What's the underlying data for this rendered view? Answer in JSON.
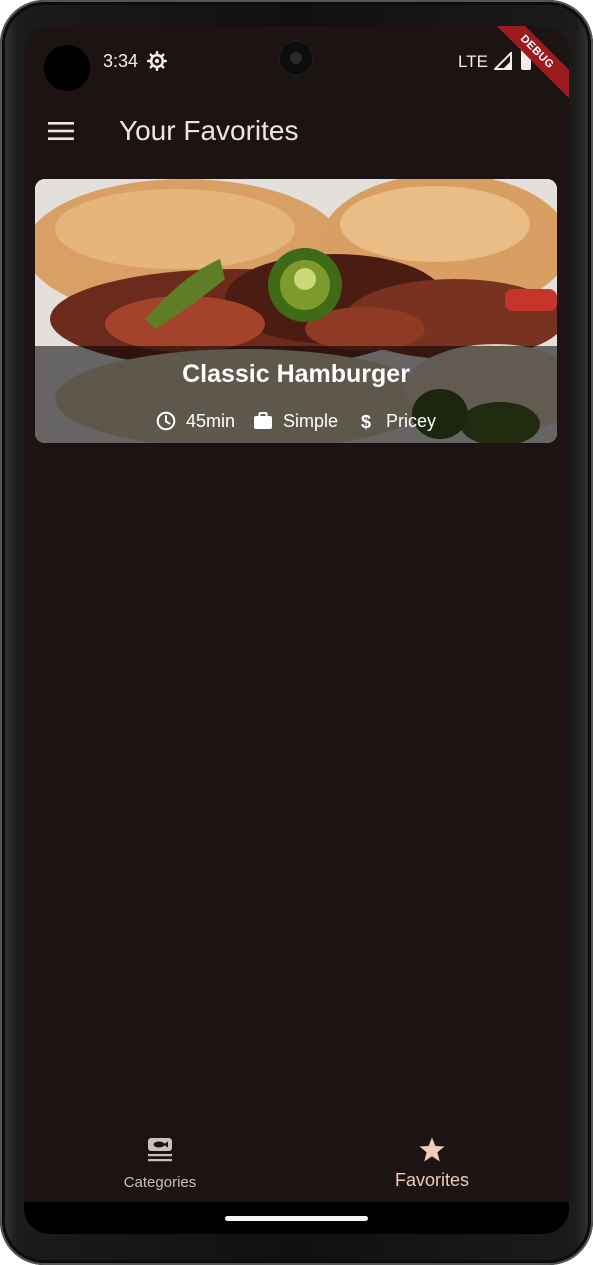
{
  "status_bar": {
    "time": "3:34",
    "network": "LTE",
    "debug_label": "DEBUG"
  },
  "app_bar": {
    "title": "Your Favorites",
    "menu_icon": "menu-icon"
  },
  "meals": [
    {
      "title": "Classic Hamburger",
      "duration": "45min",
      "complexity": "Simple",
      "affordability": "Pricey",
      "icons": [
        "clock-icon",
        "briefcase-icon",
        "dollar-icon"
      ]
    }
  ],
  "bottom_nav": {
    "items": [
      {
        "label": "Categories",
        "icon": "set-meal-icon",
        "selected": false
      },
      {
        "label": "Favorites",
        "icon": "star-icon",
        "selected": true
      }
    ]
  },
  "colors": {
    "background": "#1c1412",
    "title": "#f1e4e0",
    "selected_nav": "#f0cbbd",
    "debug_banner": "#9b1b1f"
  }
}
